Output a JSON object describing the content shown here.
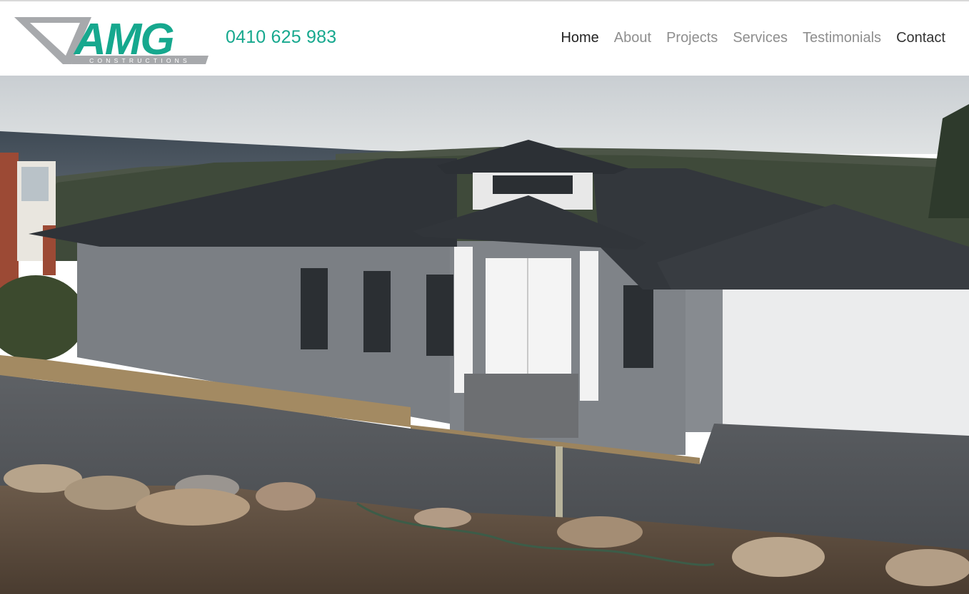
{
  "brand": {
    "logo_text": "AMG",
    "logo_subtext": "CONSTRUCTIONS",
    "phone": "0410 625 983",
    "accent_color": "#16a88e",
    "logo_gray": "#a7a9ac"
  },
  "nav": {
    "items": [
      {
        "label": "Home",
        "active": true
      },
      {
        "label": "About",
        "active": false
      },
      {
        "label": "Projects",
        "active": false
      },
      {
        "label": "Services",
        "active": false
      },
      {
        "label": "Testimonials",
        "active": false
      },
      {
        "label": "Contact",
        "active": false
      }
    ]
  },
  "hero": {
    "image": "house-photo"
  }
}
